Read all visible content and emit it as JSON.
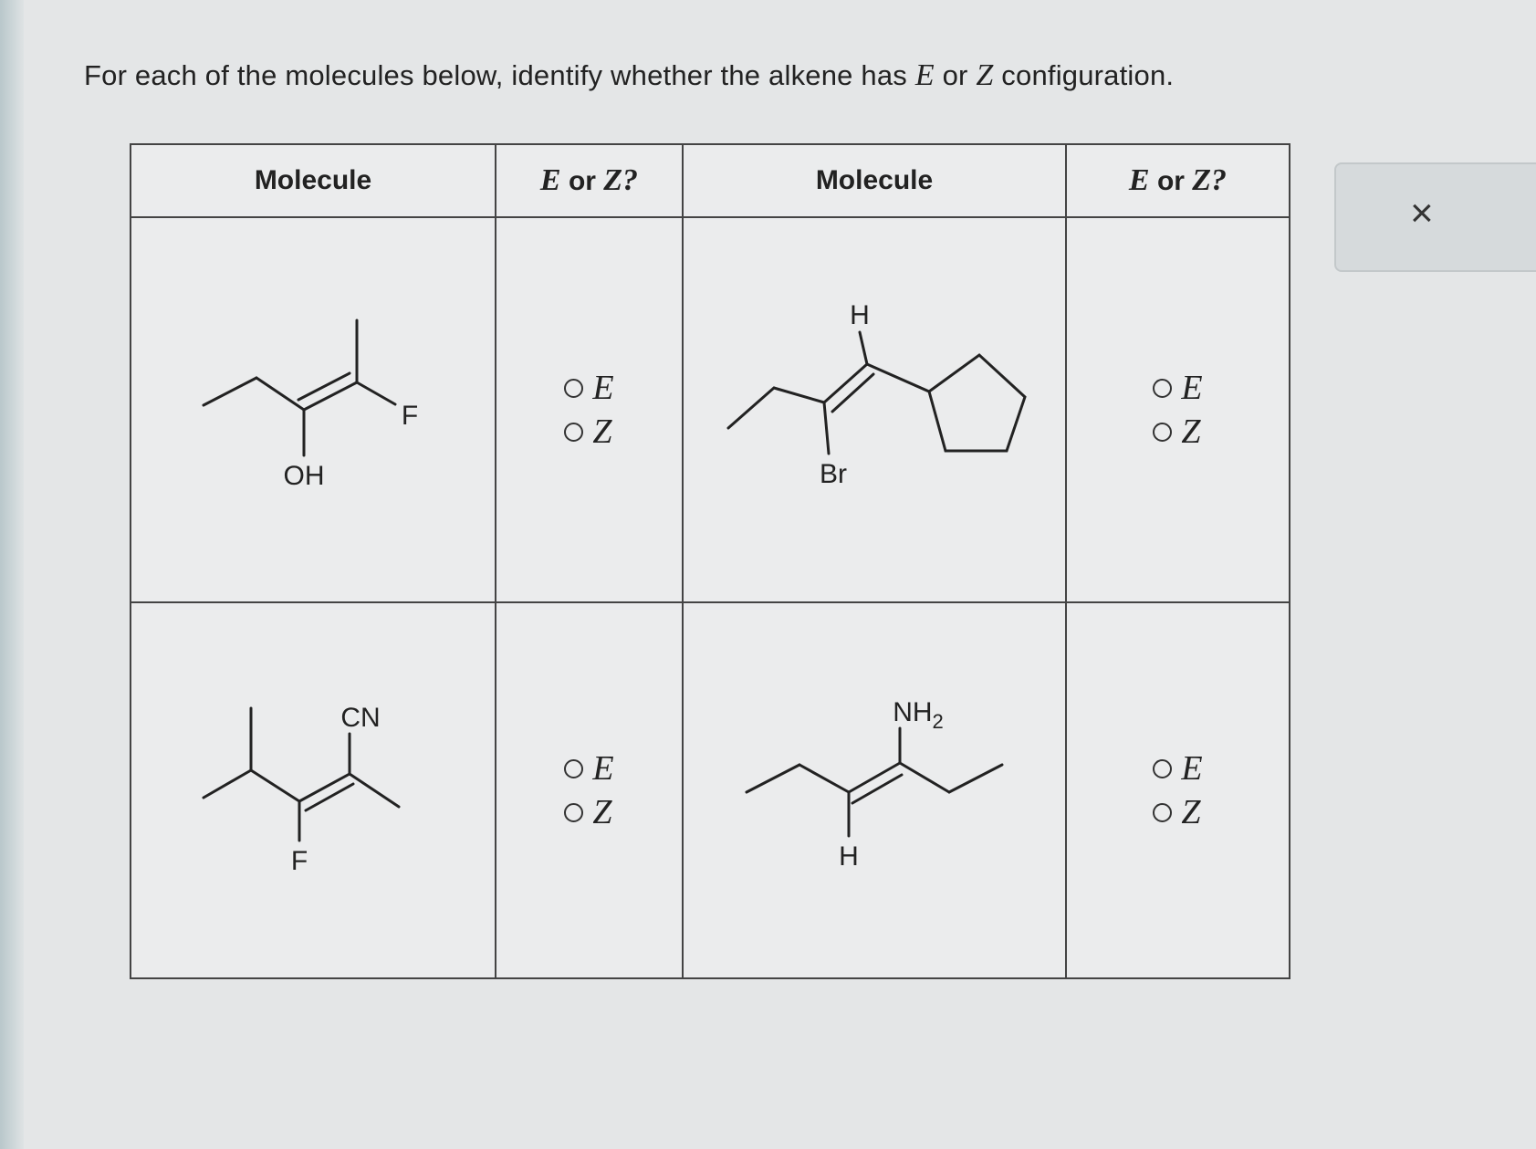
{
  "question": {
    "prefix": "For each of the molecules below, identify whether the alkene has ",
    "var_e": "E",
    "middle": " or ",
    "var_z": "Z",
    "suffix": " configuration."
  },
  "table": {
    "headers": {
      "molecule": "Molecule",
      "ez_var_e": "E",
      "ez_or": " or ",
      "ez_var_z": "Z?"
    },
    "molecules": [
      {
        "labels": [
          "OH",
          "F"
        ]
      },
      {
        "labels": [
          "H",
          "Br"
        ]
      },
      {
        "labels": [
          "CN",
          "F"
        ]
      },
      {
        "labels": [
          "NH",
          "2",
          "H"
        ]
      }
    ],
    "options": [
      "E",
      "Z"
    ]
  },
  "close_label": "×"
}
